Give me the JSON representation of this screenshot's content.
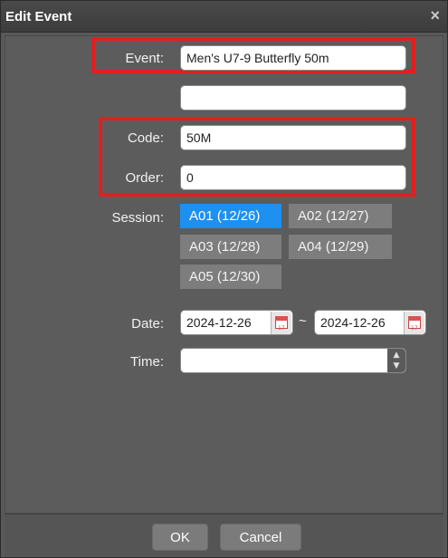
{
  "dialog": {
    "title": "Edit Event",
    "close_glyph": "×"
  },
  "form": {
    "event_label": "Event:",
    "event_value": "Men's U7-9 Butterfly 50m",
    "event_secondary_value": "",
    "code_label": "Code:",
    "code_value": "50M",
    "order_label": "Order:",
    "order_value": "0",
    "session_label": "Session:",
    "sessions": [
      {
        "label": "A01 (12/26)",
        "selected": true
      },
      {
        "label": "A02 (12/27)",
        "selected": false
      },
      {
        "label": "A03 (12/28)",
        "selected": false
      },
      {
        "label": "A04 (12/29)",
        "selected": false
      },
      {
        "label": "A05 (12/30)",
        "selected": false
      }
    ],
    "date_label": "Date:",
    "date_from": "2024-12-26",
    "date_separator": "~",
    "date_to": "2024-12-26",
    "calendar_icon_text": "17",
    "time_label": "Time:",
    "time_value": "",
    "spin_up": "▲",
    "spin_down": "▼"
  },
  "footer": {
    "ok_label": "OK",
    "cancel_label": "Cancel"
  },
  "colors": {
    "highlight": "#e02020",
    "session_active": "#1e90f0",
    "session_inactive": "#7d7d7d"
  },
  "icons": [
    "close-icon",
    "calendar-icon",
    "spin-up-icon",
    "spin-down-icon"
  ]
}
